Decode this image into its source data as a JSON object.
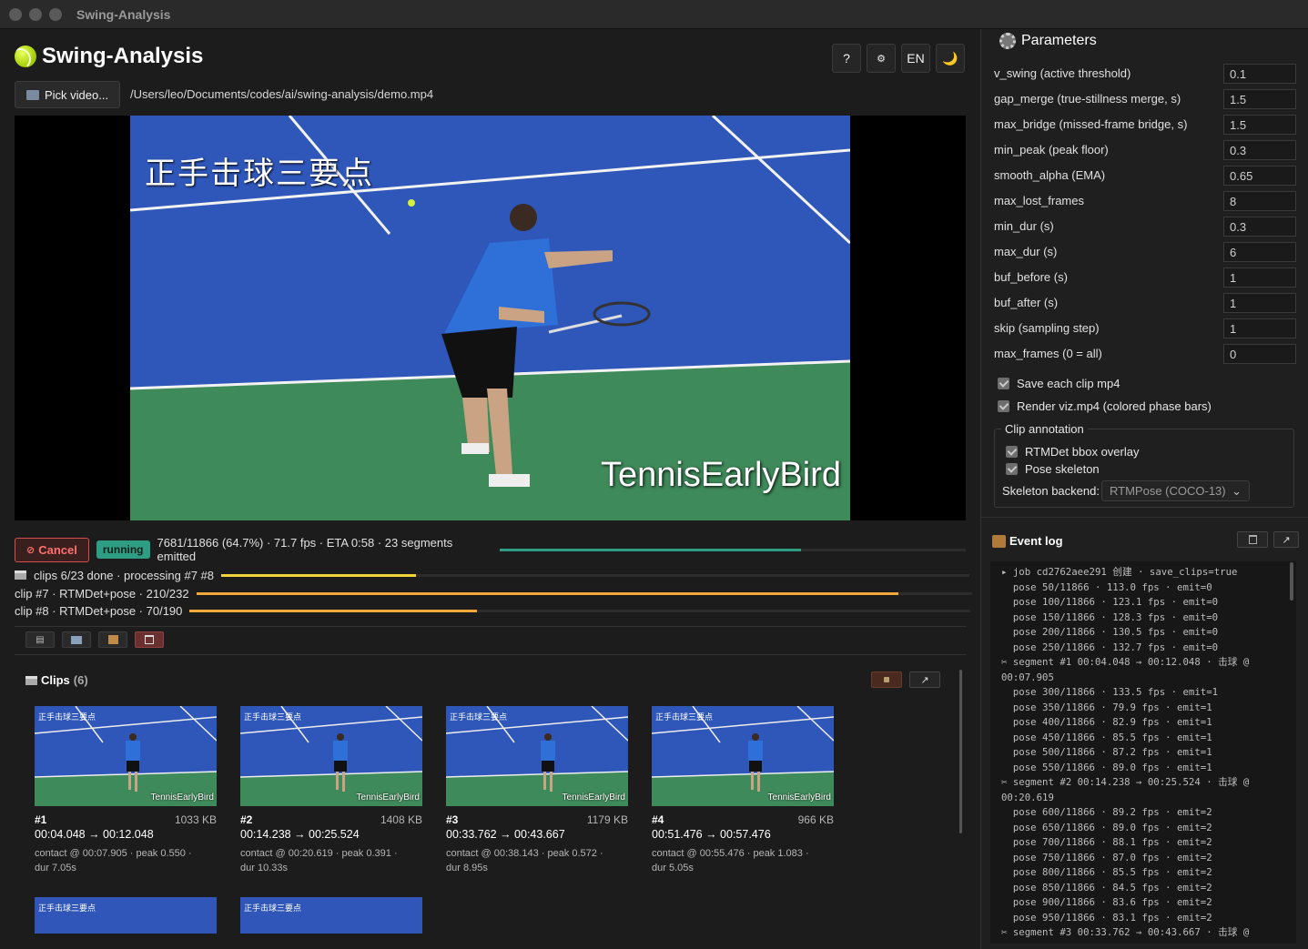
{
  "window": {
    "title": "Swing-Analysis"
  },
  "app": {
    "title": "Swing-Analysis"
  },
  "top_buttons": {
    "help": "?",
    "settings": "⚙",
    "lang": "EN",
    "theme": "🌙"
  },
  "file": {
    "pick_label": "Pick video...",
    "path": "/Users/leo/Documents/codes/ai/swing-analysis/demo.mp4"
  },
  "video": {
    "overlay_text": "正手击球三要点",
    "watermark": "TennisEarlyBird"
  },
  "status": {
    "cancel_label": "Cancel",
    "state": "running",
    "text": "7681/11866 (64.7%) · 71.7 fps · ETA 0:58 · 23 segments emitted",
    "progress": 0.647
  },
  "sub_progress": [
    {
      "label": "clips 6/23 done · processing #7 #8",
      "progress": 0.26,
      "color": "#f2d43a"
    },
    {
      "label": "clip #7 · RTMDet+pose · 210/232",
      "progress": 0.905,
      "color": "#f0a83a"
    },
    {
      "label": "clip #8 · RTMDet+pose · 70/190",
      "progress": 0.368,
      "color": "#f0a83a"
    }
  ],
  "clips": {
    "title": "Clips",
    "count": "(6)",
    "items": [
      {
        "num": "#1",
        "size": "1033 KB",
        "time": "00:04.048 → 00:12.048",
        "detail1": "contact @ 00:07.905 · peak 0.550 ·",
        "detail2": "dur 7.05s"
      },
      {
        "num": "#2",
        "size": "1408 KB",
        "time": "00:14.238 → 00:25.524",
        "detail1": "contact @ 00:20.619 · peak 0.391 ·",
        "detail2": "dur 10.33s"
      },
      {
        "num": "#3",
        "size": "1179 KB",
        "time": "00:33.762 → 00:43.667",
        "detail1": "contact @ 00:38.143 · peak 0.572 ·",
        "detail2": "dur 8.95s"
      },
      {
        "num": "#4",
        "size": "966 KB",
        "time": "00:51.476 → 00:57.476",
        "detail1": "contact @ 00:55.476 · peak 1.083 ·",
        "detail2": "dur 5.05s"
      }
    ],
    "thumb_text": "正手击球三要点",
    "thumb_watermark": "TennisEarlyBird"
  },
  "params": {
    "title": "Parameters",
    "rows": [
      {
        "label": "v_swing (active threshold)",
        "value": "0.1"
      },
      {
        "label": "gap_merge (true-stillness merge, s)",
        "value": "1.5"
      },
      {
        "label": "max_bridge (missed-frame bridge, s)",
        "value": "1.5"
      },
      {
        "label": "min_peak (peak floor)",
        "value": "0.3"
      },
      {
        "label": "smooth_alpha (EMA)",
        "value": "0.65"
      },
      {
        "label": "max_lost_frames",
        "value": "8"
      },
      {
        "label": "min_dur (s)",
        "value": "0.3"
      },
      {
        "label": "max_dur (s)",
        "value": "6"
      },
      {
        "label": "buf_before (s)",
        "value": "1"
      },
      {
        "label": "buf_after (s)",
        "value": "1"
      },
      {
        "label": "skip (sampling step)",
        "value": "1"
      },
      {
        "label": "max_frames (0 = all)",
        "value": "0"
      }
    ],
    "save_clip": "Save each clip mp4",
    "render_viz": "Render viz.mp4 (colored phase bars)",
    "annotation_legend": "Clip annotation",
    "bbox_overlay": "RTMDet bbox overlay",
    "pose_skeleton": "Pose skeleton",
    "skeleton_backend_label": "Skeleton backend:",
    "skeleton_backend_value": "RTMPose (COCO-13)"
  },
  "log": {
    "title": "Event log",
    "lines": [
      "▸ job cd2762aee291 创建 · save_clips=true",
      "  pose 50/11866 · 113.0 fps · emit=0",
      "  pose 100/11866 · 123.1 fps · emit=0",
      "  pose 150/11866 · 128.3 fps · emit=0",
      "  pose 200/11866 · 130.5 fps · emit=0",
      "  pose 250/11866 · 132.7 fps · emit=0",
      "✂ segment #1 00:04.048 → 00:12.048 · 击球 @",
      "00:07.905",
      "  pose 300/11866 · 133.5 fps · emit=1",
      "  pose 350/11866 · 79.9 fps · emit=1",
      "  pose 400/11866 · 82.9 fps · emit=1",
      "  pose 450/11866 · 85.5 fps · emit=1",
      "  pose 500/11866 · 87.2 fps · emit=1",
      "  pose 550/11866 · 89.0 fps · emit=1",
      "✂ segment #2 00:14.238 → 00:25.524 · 击球 @",
      "00:20.619",
      "  pose 600/11866 · 89.2 fps · emit=2",
      "  pose 650/11866 · 89.0 fps · emit=2",
      "  pose 700/11866 · 88.1 fps · emit=2",
      "  pose 750/11866 · 87.0 fps · emit=2",
      "  pose 800/11866 · 85.5 fps · emit=2",
      "  pose 850/11866 · 84.5 fps · emit=2",
      "  pose 900/11866 · 83.6 fps · emit=2",
      "  pose 950/11866 · 83.1 fps · emit=2",
      "✂ segment #3 00:33.762 → 00:43.667 · 击球 @"
    ]
  }
}
